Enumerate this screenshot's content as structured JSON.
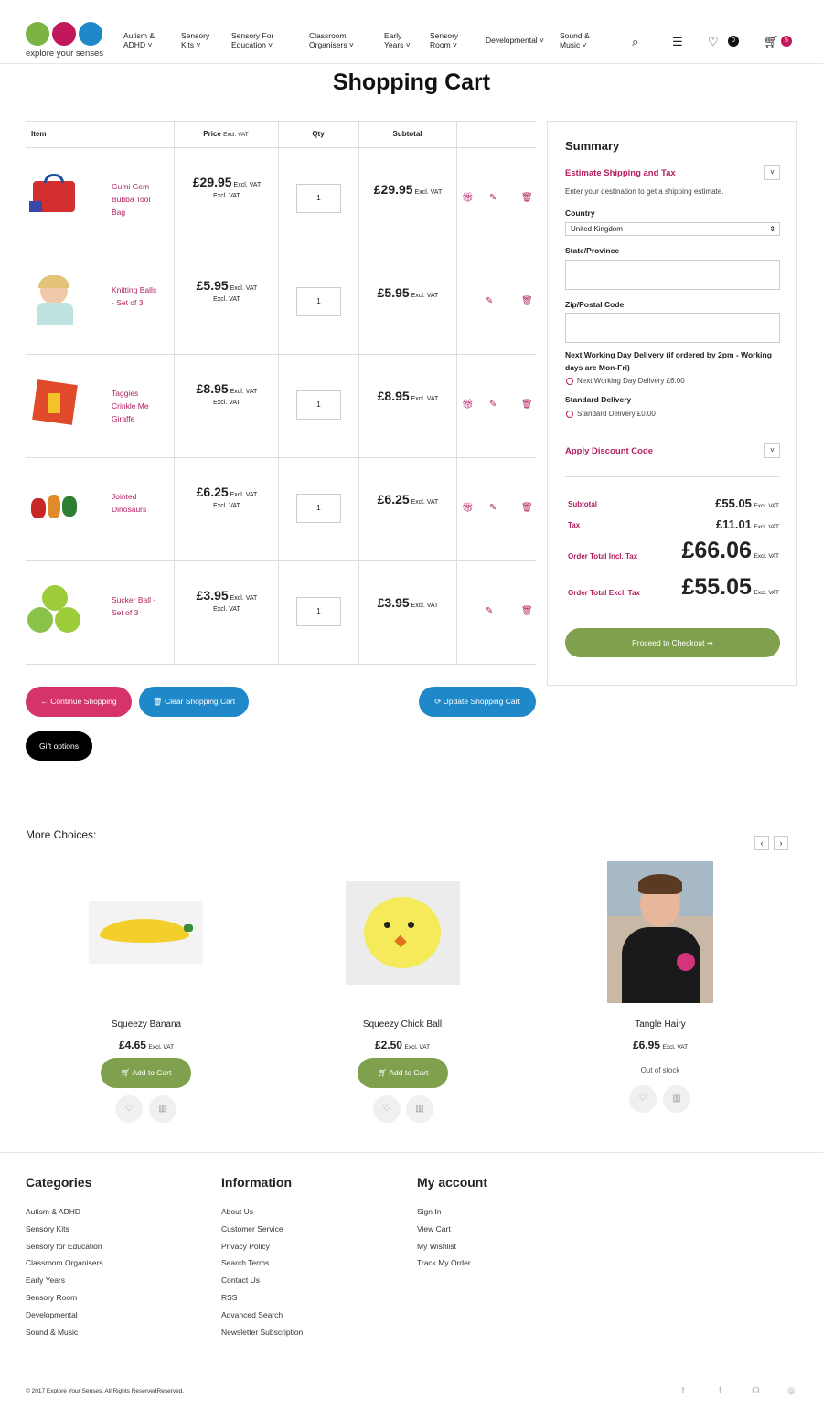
{
  "header": {
    "logo_text": "explore your senses",
    "nav": [
      {
        "l1": "Autism &",
        "l2": "ADHD ˅"
      },
      {
        "l1": "Sensory",
        "l2": "Kits ˅"
      },
      {
        "l1": "Sensory For",
        "l2": "Education ˅"
      },
      {
        "l1": "Classroom",
        "l2": "Organisers ˅"
      },
      {
        "l1": "Early",
        "l2": "Years ˅"
      },
      {
        "l1": "Sensory",
        "l2": "Room ˅"
      },
      {
        "l1": "Developmental ˅",
        "l2": ""
      },
      {
        "l1": "Sound &",
        "l2": "Music ˅"
      }
    ],
    "wishlist_count": "0",
    "cart_count": "5"
  },
  "page_title": "Shopping Cart",
  "cart": {
    "headers": {
      "item": "Item",
      "price": "Price",
      "price_note": "Excl. VAT",
      "qty": "Qty",
      "subtotal": "Subtotal"
    },
    "excl": "Excl. VAT",
    "items": [
      {
        "name": "Gumi Gem Bubba Tool Bag",
        "price": "£29.95",
        "qty": "1",
        "subtotal": "£29.95",
        "gift": true
      },
      {
        "name": "Knitting Balls - Set of 3",
        "price": "£5.95",
        "qty": "1",
        "subtotal": "£5.95",
        "gift": false
      },
      {
        "name": "Taggies Crinkle Me Giraffe",
        "price": "£8.95",
        "qty": "1",
        "subtotal": "£8.95",
        "gift": true
      },
      {
        "name": "Jointed Dinosaurs",
        "price": "£6.25",
        "qty": "1",
        "subtotal": "£6.25",
        "gift": true
      },
      {
        "name": "Sucker Ball - Set of 3",
        "price": "£3.95",
        "qty": "1",
        "subtotal": "£3.95",
        "gift": false
      }
    ],
    "btn_continue": "Continue Shopping",
    "btn_clear": "Clear Shopping Cart",
    "btn_update": "Update Shopping Cart",
    "btn_gift": "Gift options"
  },
  "summary": {
    "title": "Summary",
    "est_title": "Estimate Shipping and Tax",
    "est_desc": "Enter your destination to get a shipping estimate.",
    "country_label": "Country",
    "country_value": "United Kingdom",
    "state_label": "State/Province",
    "zip_label": "Zip/Postal Code",
    "nextday_title": "Next Working Day Delivery (if ordered by 2pm - Working days are Mon-Fri)",
    "nextday_opt": "Next Working Day Delivery £6.00",
    "std_title": "Standard Delivery",
    "std_opt": "Standard Delivery £0.00",
    "discount": "Apply Discount Code",
    "subtotal_label": "Subtotal",
    "subtotal": "£55.05",
    "tax_label": "Tax",
    "tax": "£11.01",
    "incl_label": "Order Total Incl. Tax",
    "incl": "£66.06",
    "excl_label": "Order Total Excl. Tax",
    "excl": "£55.05",
    "excl_vat": "Excl. VAT",
    "checkout": "Proceed to Checkout"
  },
  "more": {
    "title": "More Choices:",
    "products": [
      {
        "name": "Squeezy Banana",
        "price": "£4.65",
        "action": "Add to Cart"
      },
      {
        "name": "Squeezy Chick Ball",
        "price": "£2.50",
        "action": "Add to Cart"
      },
      {
        "name": "Tangle Hairy",
        "price": "£6.95",
        "stock": "Out of stock"
      }
    ],
    "excl": "Excl. VAT"
  },
  "footer": {
    "categories": {
      "title": "Categories",
      "links": [
        "Autism & ADHD",
        "Sensory Kits",
        "Sensory for Education",
        "Classroom Organisers",
        "Early Years",
        "Sensory Room",
        "Developmental",
        "Sound & Music"
      ]
    },
    "information": {
      "title": "Information",
      "links": [
        "About Us",
        "Customer Service",
        "Privacy Policy",
        "Search Terms",
        "Contact Us",
        "RSS",
        "Advanced Search",
        "Newsletter Subscription"
      ]
    },
    "account": {
      "title": "My account",
      "links": [
        "Sign In",
        "View Cart",
        "My Wishlist",
        "Track My Order"
      ]
    },
    "copyright": "© 2017 Explore Your Senses. All Rights ReservedReserved."
  },
  "colors": {
    "accent": "#b21f5f",
    "pink": "#d6336c",
    "blue": "#1e88c8",
    "green": "#7fa04d"
  }
}
